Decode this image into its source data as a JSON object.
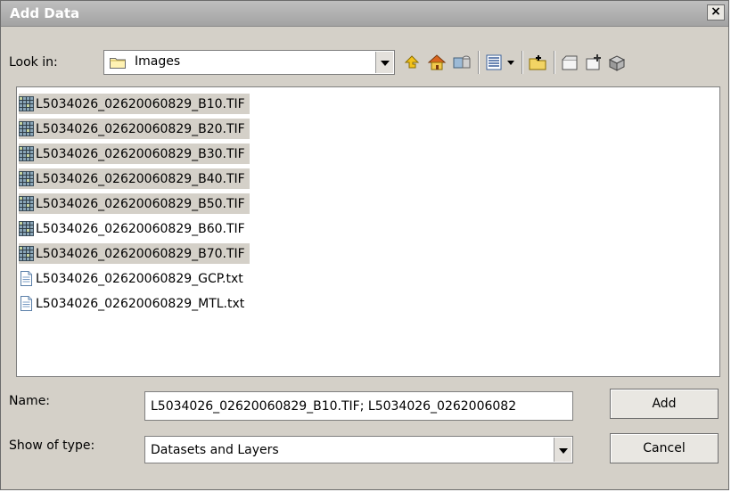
{
  "window": {
    "title": "Add Data",
    "close_label": "×"
  },
  "lookin": {
    "label": "Look in:",
    "value": "Images"
  },
  "toolbar": {
    "icons": [
      "up-one-level-icon",
      "home-icon",
      "connect-folder-icon",
      "view-list-icon",
      "view-dropdown-icon",
      "new-folder-icon",
      "new-item-icon",
      "new-item2-icon",
      "new-item3-icon"
    ]
  },
  "files": [
    {
      "name": "L5034026_02620060829_B10.TIF",
      "type": "raster",
      "selected": true
    },
    {
      "name": "L5034026_02620060829_B20.TIF",
      "type": "raster",
      "selected": true
    },
    {
      "name": "L5034026_02620060829_B30.TIF",
      "type": "raster",
      "selected": true
    },
    {
      "name": "L5034026_02620060829_B40.TIF",
      "type": "raster",
      "selected": true
    },
    {
      "name": "L5034026_02620060829_B50.TIF",
      "type": "raster",
      "selected": true
    },
    {
      "name": "L5034026_02620060829_B60.TIF",
      "type": "raster",
      "selected": false
    },
    {
      "name": "L5034026_02620060829_B70.TIF",
      "type": "raster",
      "selected": true
    },
    {
      "name": "L5034026_02620060829_GCP.txt",
      "type": "text",
      "selected": false
    },
    {
      "name": "L5034026_02620060829_MTL.txt",
      "type": "text",
      "selected": false
    }
  ],
  "name_field": {
    "label": "Name:",
    "value": "L5034026_02620060829_B10.TIF; L5034026_0262006082"
  },
  "type_field": {
    "label": "Show of type:",
    "value": "Datasets and Layers"
  },
  "buttons": {
    "add": "Add",
    "cancel": "Cancel"
  },
  "colors": {
    "dialog_bg": "#d4d0c8",
    "titlebar": "#a8a8a8",
    "selection": "#d4d0c8"
  }
}
